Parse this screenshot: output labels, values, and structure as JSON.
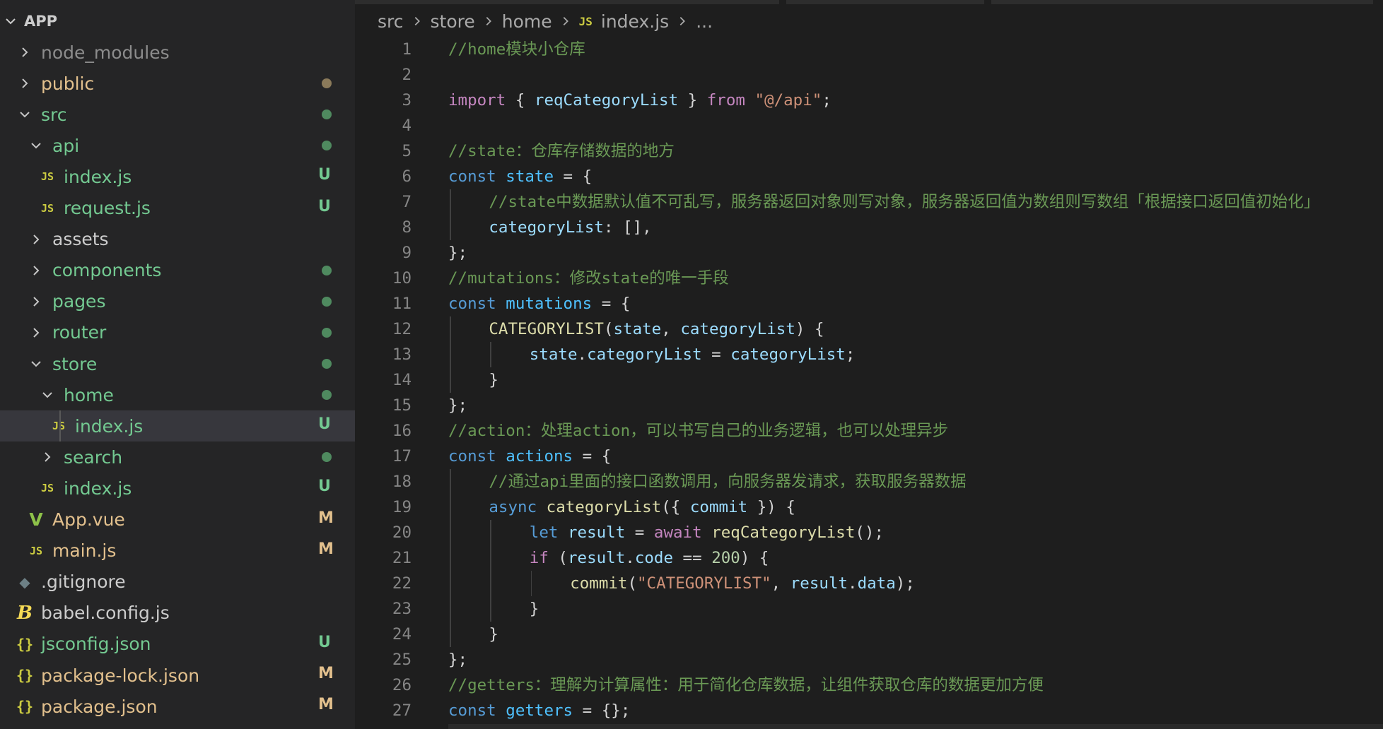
{
  "colors": {
    "ignored": "#8c8c8c",
    "modified": "#e2c08d",
    "untracked": "#73c991",
    "dot_modified": "#8b7a5a",
    "dot_untracked": "#4f8a5f",
    "selected_row": "#37373d"
  },
  "explorer": {
    "root_label": "APP",
    "items": [
      {
        "label": "node_modules",
        "kind": "folder",
        "open": false,
        "depth": 1,
        "color": "ignored",
        "status": "",
        "dot": ""
      },
      {
        "label": "public",
        "kind": "folder",
        "open": false,
        "depth": 1,
        "color": "modified",
        "status": "",
        "dot": "modified"
      },
      {
        "label": "src",
        "kind": "folder",
        "open": true,
        "depth": 1,
        "color": "untracked",
        "status": "",
        "dot": "untracked"
      },
      {
        "label": "api",
        "kind": "folder",
        "open": true,
        "depth": 2,
        "color": "untracked",
        "status": "",
        "dot": "untracked"
      },
      {
        "label": "index.js",
        "kind": "js",
        "depth": 3,
        "color": "untracked",
        "status": "U",
        "dot": ""
      },
      {
        "label": "request.js",
        "kind": "js",
        "depth": 3,
        "color": "untracked",
        "status": "U",
        "dot": ""
      },
      {
        "label": "assets",
        "kind": "folder",
        "open": false,
        "depth": 2,
        "color": "plain",
        "status": "",
        "dot": ""
      },
      {
        "label": "components",
        "kind": "folder",
        "open": false,
        "depth": 2,
        "color": "untracked",
        "status": "",
        "dot": "untracked"
      },
      {
        "label": "pages",
        "kind": "folder",
        "open": false,
        "depth": 2,
        "color": "untracked",
        "status": "",
        "dot": "untracked"
      },
      {
        "label": "router",
        "kind": "folder",
        "open": false,
        "depth": 2,
        "color": "untracked",
        "status": "",
        "dot": "untracked"
      },
      {
        "label": "store",
        "kind": "folder",
        "open": true,
        "depth": 2,
        "color": "untracked",
        "status": "",
        "dot": "untracked"
      },
      {
        "label": "home",
        "kind": "folder",
        "open": true,
        "depth": 3,
        "color": "untracked",
        "status": "",
        "dot": "untracked"
      },
      {
        "label": "index.js",
        "kind": "js",
        "depth": 4,
        "color": "untracked",
        "status": "U",
        "dot": "",
        "selected": true
      },
      {
        "label": "search",
        "kind": "folder",
        "open": false,
        "depth": 3,
        "color": "untracked",
        "status": "",
        "dot": "untracked"
      },
      {
        "label": "index.js",
        "kind": "js",
        "depth": 3,
        "color": "untracked",
        "status": "U",
        "dot": ""
      },
      {
        "label": "App.vue",
        "kind": "vue",
        "depth": 2,
        "color": "modified",
        "status": "M",
        "dot": ""
      },
      {
        "label": "main.js",
        "kind": "js",
        "depth": 2,
        "color": "modified",
        "status": "M",
        "dot": ""
      },
      {
        "label": ".gitignore",
        "kind": "git",
        "depth": 1,
        "color": "plain",
        "status": "",
        "dot": ""
      },
      {
        "label": "babel.config.js",
        "kind": "babel",
        "depth": 1,
        "color": "plain",
        "status": "",
        "dot": ""
      },
      {
        "label": "jsconfig.json",
        "kind": "json",
        "depth": 1,
        "color": "untracked",
        "status": "U",
        "dot": ""
      },
      {
        "label": "package-lock.json",
        "kind": "json",
        "depth": 1,
        "color": "modified",
        "status": "M",
        "dot": ""
      },
      {
        "label": "package.json",
        "kind": "json",
        "depth": 1,
        "color": "modified",
        "status": "M",
        "dot": ""
      }
    ]
  },
  "breadcrumb": {
    "parts": [
      "src",
      "store",
      "home"
    ],
    "file_icon": "JS",
    "file": "index.js",
    "ellipsis": "..."
  },
  "editor": {
    "lines": [
      {
        "n": "1",
        "indent": 0,
        "tokens": [
          [
            "cm",
            "//home模块小仓库"
          ]
        ]
      },
      {
        "n": "2",
        "indent": 0,
        "tokens": []
      },
      {
        "n": "3",
        "indent": 0,
        "tokens": [
          [
            "kc",
            "import"
          ],
          [
            "p",
            " { "
          ],
          [
            "v",
            "reqCategoryList"
          ],
          [
            "p",
            " } "
          ],
          [
            "kc",
            "from"
          ],
          [
            "p",
            " "
          ],
          [
            "s",
            "\"@/api\""
          ],
          [
            "p",
            ";"
          ]
        ]
      },
      {
        "n": "4",
        "indent": 0,
        "tokens": []
      },
      {
        "n": "5",
        "indent": 0,
        "tokens": [
          [
            "cm",
            "//state：仓库存储数据的地方"
          ]
        ]
      },
      {
        "n": "6",
        "indent": 0,
        "tokens": [
          [
            "k",
            "const"
          ],
          [
            "p",
            " "
          ],
          [
            "vc",
            "state"
          ],
          [
            "p",
            " = {"
          ]
        ]
      },
      {
        "n": "7",
        "indent": 1,
        "tokens": [
          [
            "cm",
            "//state中数据默认值不可乱写，服务器返回对象则写对象，服务器返回值为数组则写数组「根据接口返回值初始化」"
          ]
        ]
      },
      {
        "n": "8",
        "indent": 1,
        "tokens": [
          [
            "v",
            "categoryList"
          ],
          [
            "p",
            ": [],"
          ]
        ]
      },
      {
        "n": "9",
        "indent": 0,
        "tokens": [
          [
            "p",
            "};"
          ]
        ]
      },
      {
        "n": "10",
        "indent": 0,
        "tokens": [
          [
            "cm",
            "//mutations：修改state的唯一手段"
          ]
        ]
      },
      {
        "n": "11",
        "indent": 0,
        "tokens": [
          [
            "k",
            "const"
          ],
          [
            "p",
            " "
          ],
          [
            "vc",
            "mutations"
          ],
          [
            "p",
            " = {"
          ]
        ]
      },
      {
        "n": "12",
        "indent": 1,
        "tokens": [
          [
            "fn",
            "CATEGORYLIST"
          ],
          [
            "p",
            "("
          ],
          [
            "v",
            "state"
          ],
          [
            "p",
            ", "
          ],
          [
            "v",
            "categoryList"
          ],
          [
            "p",
            ") {"
          ]
        ]
      },
      {
        "n": "13",
        "indent": 2,
        "tokens": [
          [
            "v",
            "state"
          ],
          [
            "p",
            "."
          ],
          [
            "v",
            "categoryList"
          ],
          [
            "p",
            " = "
          ],
          [
            "v",
            "categoryList"
          ],
          [
            "p",
            ";"
          ]
        ]
      },
      {
        "n": "14",
        "indent": 1,
        "tokens": [
          [
            "p",
            "}"
          ]
        ]
      },
      {
        "n": "15",
        "indent": 0,
        "tokens": [
          [
            "p",
            "};"
          ]
        ]
      },
      {
        "n": "16",
        "indent": 0,
        "tokens": [
          [
            "cm",
            "//action：处理action，可以书写自己的业务逻辑，也可以处理异步"
          ]
        ]
      },
      {
        "n": "17",
        "indent": 0,
        "tokens": [
          [
            "k",
            "const"
          ],
          [
            "p",
            " "
          ],
          [
            "vc",
            "actions"
          ],
          [
            "p",
            " = {"
          ]
        ]
      },
      {
        "n": "18",
        "indent": 1,
        "tokens": [
          [
            "cm",
            "//通过api里面的接口函数调用，向服务器发请求，获取服务器数据"
          ]
        ]
      },
      {
        "n": "19",
        "indent": 1,
        "tokens": [
          [
            "k",
            "async"
          ],
          [
            "p",
            " "
          ],
          [
            "fn",
            "categoryList"
          ],
          [
            "p",
            "({ "
          ],
          [
            "v",
            "commit"
          ],
          [
            "p",
            " }) {"
          ]
        ]
      },
      {
        "n": "20",
        "indent": 2,
        "tokens": [
          [
            "k",
            "let"
          ],
          [
            "p",
            " "
          ],
          [
            "v",
            "result"
          ],
          [
            "p",
            " = "
          ],
          [
            "kc",
            "await"
          ],
          [
            "p",
            " "
          ],
          [
            "fn",
            "reqCategoryList"
          ],
          [
            "p",
            "();"
          ]
        ]
      },
      {
        "n": "21",
        "indent": 2,
        "tokens": [
          [
            "kc",
            "if"
          ],
          [
            "p",
            " ("
          ],
          [
            "v",
            "result"
          ],
          [
            "p",
            "."
          ],
          [
            "v",
            "code"
          ],
          [
            "p",
            " == "
          ],
          [
            "num",
            "200"
          ],
          [
            "p",
            ") {"
          ]
        ]
      },
      {
        "n": "22",
        "indent": 3,
        "tokens": [
          [
            "fn",
            "commit"
          ],
          [
            "p",
            "("
          ],
          [
            "s",
            "\"CATEGORYLIST\""
          ],
          [
            "p",
            ", "
          ],
          [
            "v",
            "result"
          ],
          [
            "p",
            "."
          ],
          [
            "v",
            "data"
          ],
          [
            "p",
            ");"
          ]
        ]
      },
      {
        "n": "23",
        "indent": 2,
        "tokens": [
          [
            "p",
            "}"
          ]
        ]
      },
      {
        "n": "24",
        "indent": 1,
        "tokens": [
          [
            "p",
            "}"
          ]
        ]
      },
      {
        "n": "25",
        "indent": 0,
        "tokens": [
          [
            "p",
            "};"
          ]
        ]
      },
      {
        "n": "26",
        "indent": 0,
        "tokens": [
          [
            "cm",
            "//getters：理解为计算属性：用于简化仓库数据，让组件获取仓库的数据更加方便"
          ]
        ]
      },
      {
        "n": "27",
        "indent": 0,
        "tokens": [
          [
            "k",
            "const"
          ],
          [
            "p",
            " "
          ],
          [
            "vc",
            "getters"
          ],
          [
            "p",
            " = {};"
          ]
        ]
      }
    ]
  }
}
